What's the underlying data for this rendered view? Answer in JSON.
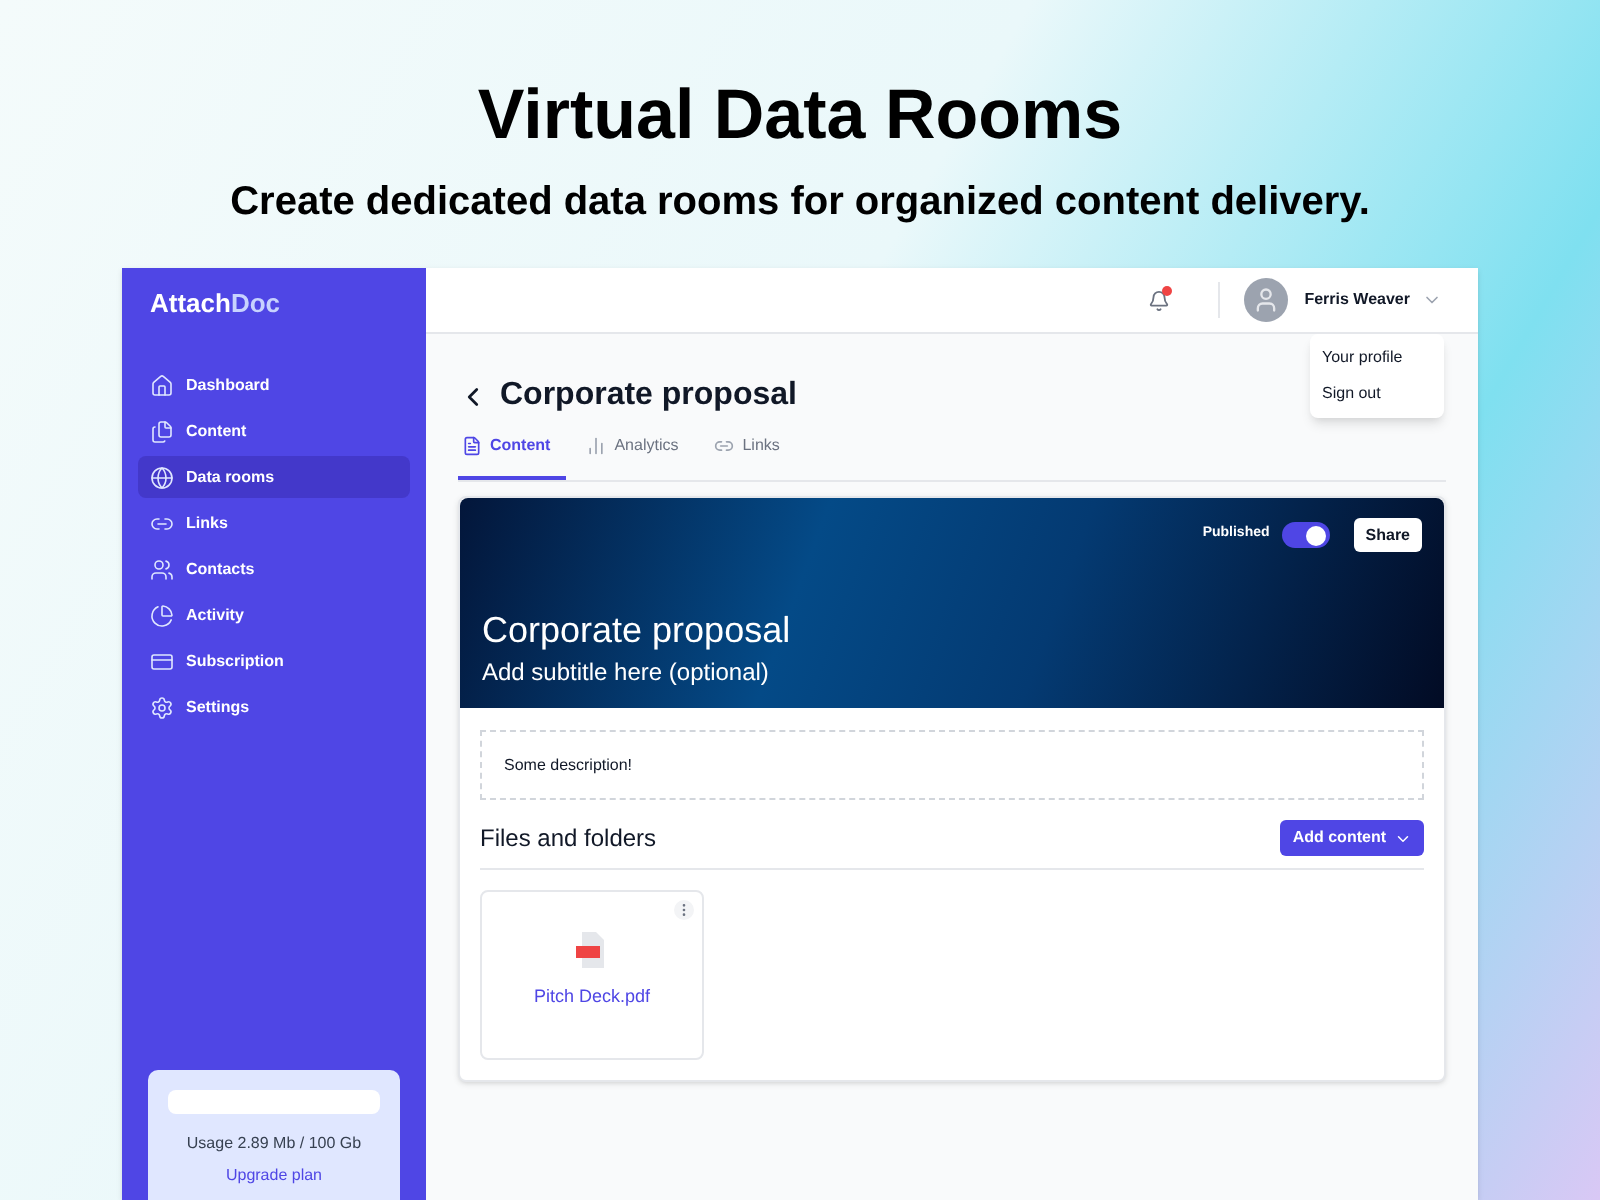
{
  "hero": {
    "title": "Virtual Data Rooms",
    "subtitle": "Create dedicated data rooms for organized content delivery."
  },
  "logo": {
    "primary": "Attach",
    "secondary": "Doc"
  },
  "sidebar": {
    "items": [
      {
        "label": "Dashboard",
        "selected": false
      },
      {
        "label": "Content",
        "selected": false
      },
      {
        "label": "Data rooms",
        "selected": true
      },
      {
        "label": "Links",
        "selected": false
      },
      {
        "label": "Contacts",
        "selected": false
      },
      {
        "label": "Activity",
        "selected": false
      },
      {
        "label": "Subscription",
        "selected": false
      },
      {
        "label": "Settings",
        "selected": false
      }
    ],
    "usage": {
      "text": "Usage 2.89 Mb / 100 Gb",
      "link": "Upgrade plan"
    }
  },
  "topbar": {
    "notification": true,
    "user": "Ferris Weaver",
    "menu": [
      "Your profile",
      "Sign out"
    ]
  },
  "page": {
    "title": "Corporate proposal",
    "tabs": [
      {
        "label": "Content",
        "selected": true
      },
      {
        "label": "Analytics",
        "selected": false
      },
      {
        "label": "Links",
        "selected": false
      }
    ],
    "banner": {
      "status": "Published",
      "published": true,
      "share": "Share",
      "title": "Corporate proposal",
      "subtitle": "Add subtitle here (optional)"
    },
    "description": "Some description!",
    "files_heading": "Files and folders",
    "add_button": "Add content",
    "files": [
      {
        "name": "Pitch Deck.pdf"
      }
    ]
  }
}
